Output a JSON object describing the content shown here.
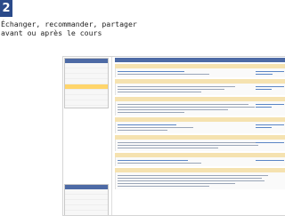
{
  "slide": {
    "number": "2",
    "heading_line1": "Échanger, recommander, partager",
    "heading_line2": "avant ou après le cours"
  },
  "screenshot": {
    "colors": {
      "header": "#4d6aa5",
      "post_head": "#f5e2b0",
      "selected_row": "#ffd56b",
      "link": "#5b86c5"
    }
  }
}
